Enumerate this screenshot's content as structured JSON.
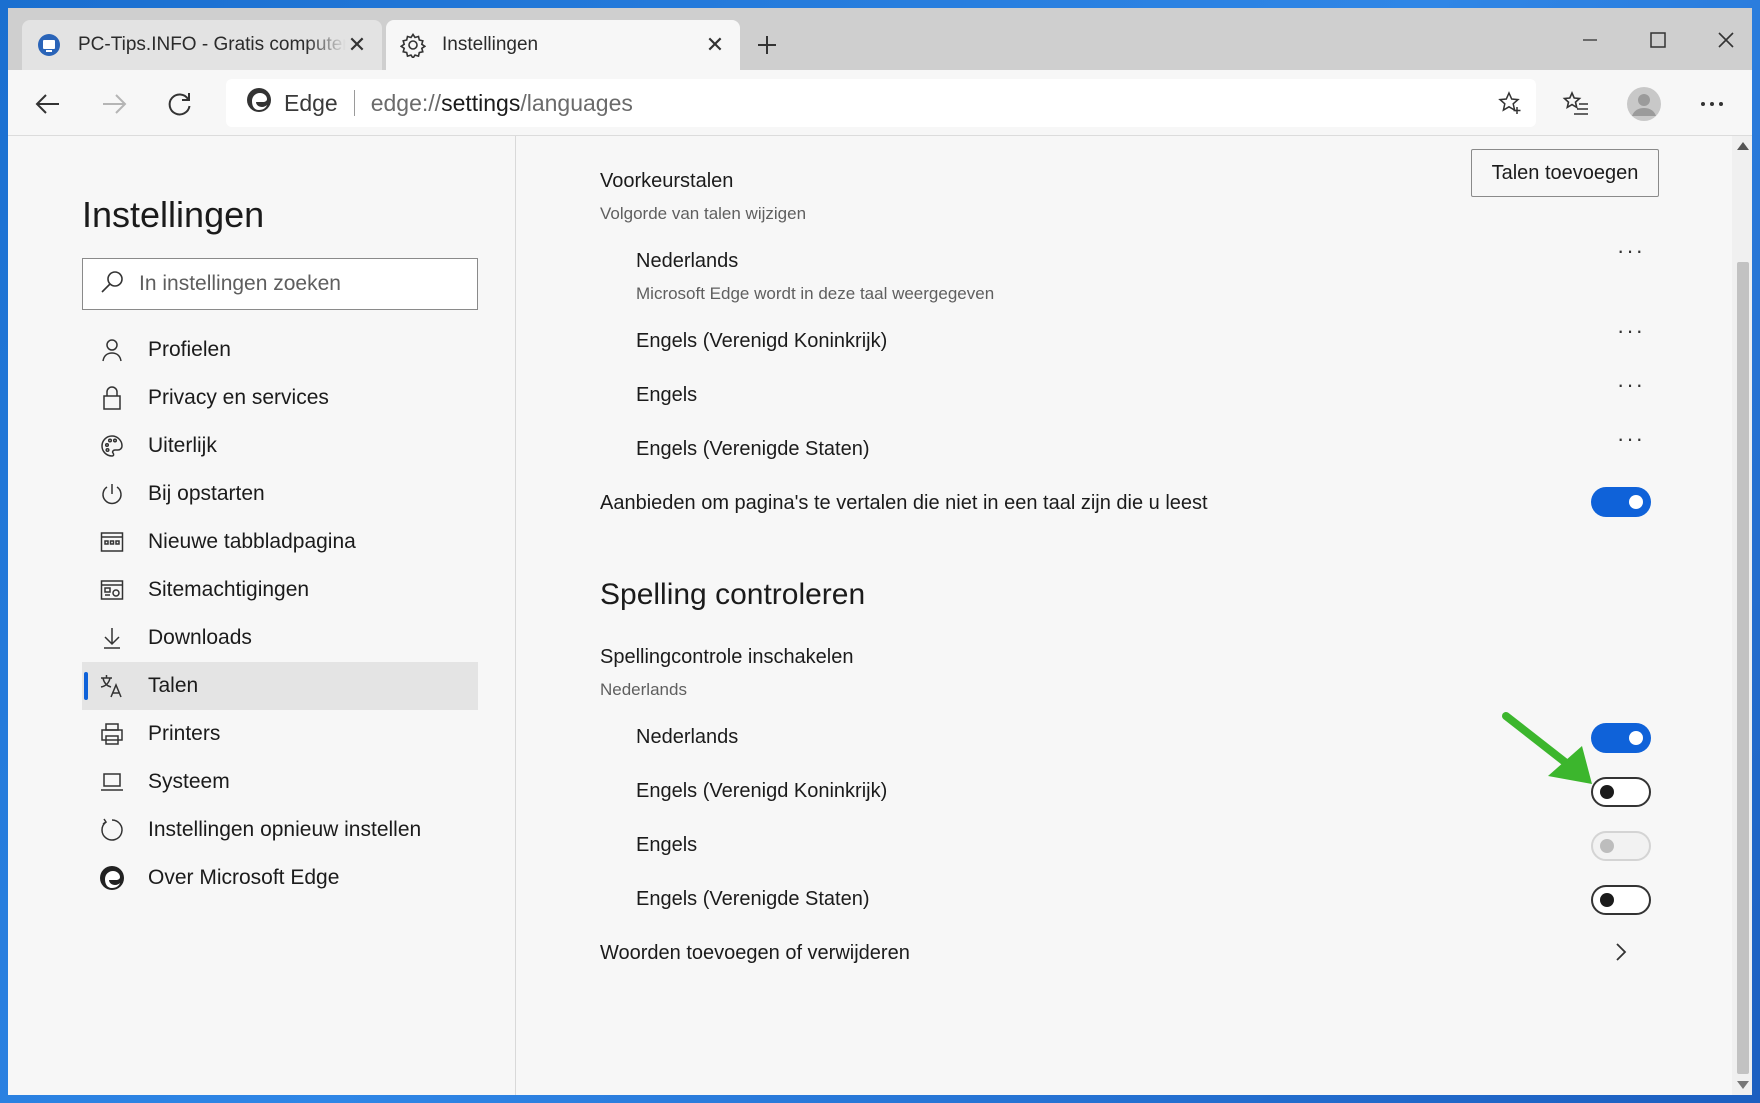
{
  "tabs": [
    {
      "title": "PC-Tips.INFO - Gratis computer tips",
      "active": false
    },
    {
      "title": "Instellingen",
      "active": true
    }
  ],
  "address": {
    "site_label": "Edge",
    "url_scheme": "edge://",
    "url_host": "settings",
    "url_path": "/languages"
  },
  "sidebar": {
    "title": "Instellingen",
    "search_placeholder": "In instellingen zoeken",
    "items": [
      {
        "label": "Profielen",
        "icon": "person-icon"
      },
      {
        "label": "Privacy en services",
        "icon": "lock-icon"
      },
      {
        "label": "Uiterlijk",
        "icon": "palette-icon"
      },
      {
        "label": "Bij opstarten",
        "icon": "power-icon"
      },
      {
        "label": "Nieuwe tabbladpagina",
        "icon": "newtab-icon"
      },
      {
        "label": "Sitemachtigingen",
        "icon": "site-permissions-icon"
      },
      {
        "label": "Downloads",
        "icon": "download-icon"
      },
      {
        "label": "Talen",
        "icon": "language-icon",
        "selected": true
      },
      {
        "label": "Printers",
        "icon": "printer-icon"
      },
      {
        "label": "Systeem",
        "icon": "laptop-icon"
      },
      {
        "label": "Instellingen opnieuw instellen",
        "icon": "reset-icon"
      },
      {
        "label": "Over Microsoft Edge",
        "icon": "edge-icon"
      }
    ]
  },
  "preferred": {
    "title": "Voorkeurstalen",
    "subtitle": "Volgorde van talen wijzigen",
    "add_button": "Talen toevoegen",
    "languages": [
      {
        "name": "Nederlands",
        "note": "Microsoft Edge wordt in deze taal weergegeven"
      },
      {
        "name": "Engels (Verenigd Koninkrijk)"
      },
      {
        "name": "Engels"
      },
      {
        "name": "Engels (Verenigde Staten)"
      }
    ],
    "translate_offer": {
      "label": "Aanbieden om pagina's te vertalen die niet in een taal zijn die u leest",
      "on": true
    }
  },
  "spelling": {
    "heading": "Spelling controleren",
    "enable_label": "Spellingcontrole inschakelen",
    "enable_sub": "Nederlands",
    "languages": [
      {
        "name": "Nederlands",
        "state": "on"
      },
      {
        "name": "Engels (Verenigd Koninkrijk)",
        "state": "off"
      },
      {
        "name": "Engels",
        "state": "disabled"
      },
      {
        "name": "Engels (Verenigde Staten)",
        "state": "off"
      }
    ],
    "words_link": "Woorden toevoegen of verwijderen"
  },
  "colors": {
    "accent": "#0f62d9",
    "arrow": "#3cb62d"
  }
}
